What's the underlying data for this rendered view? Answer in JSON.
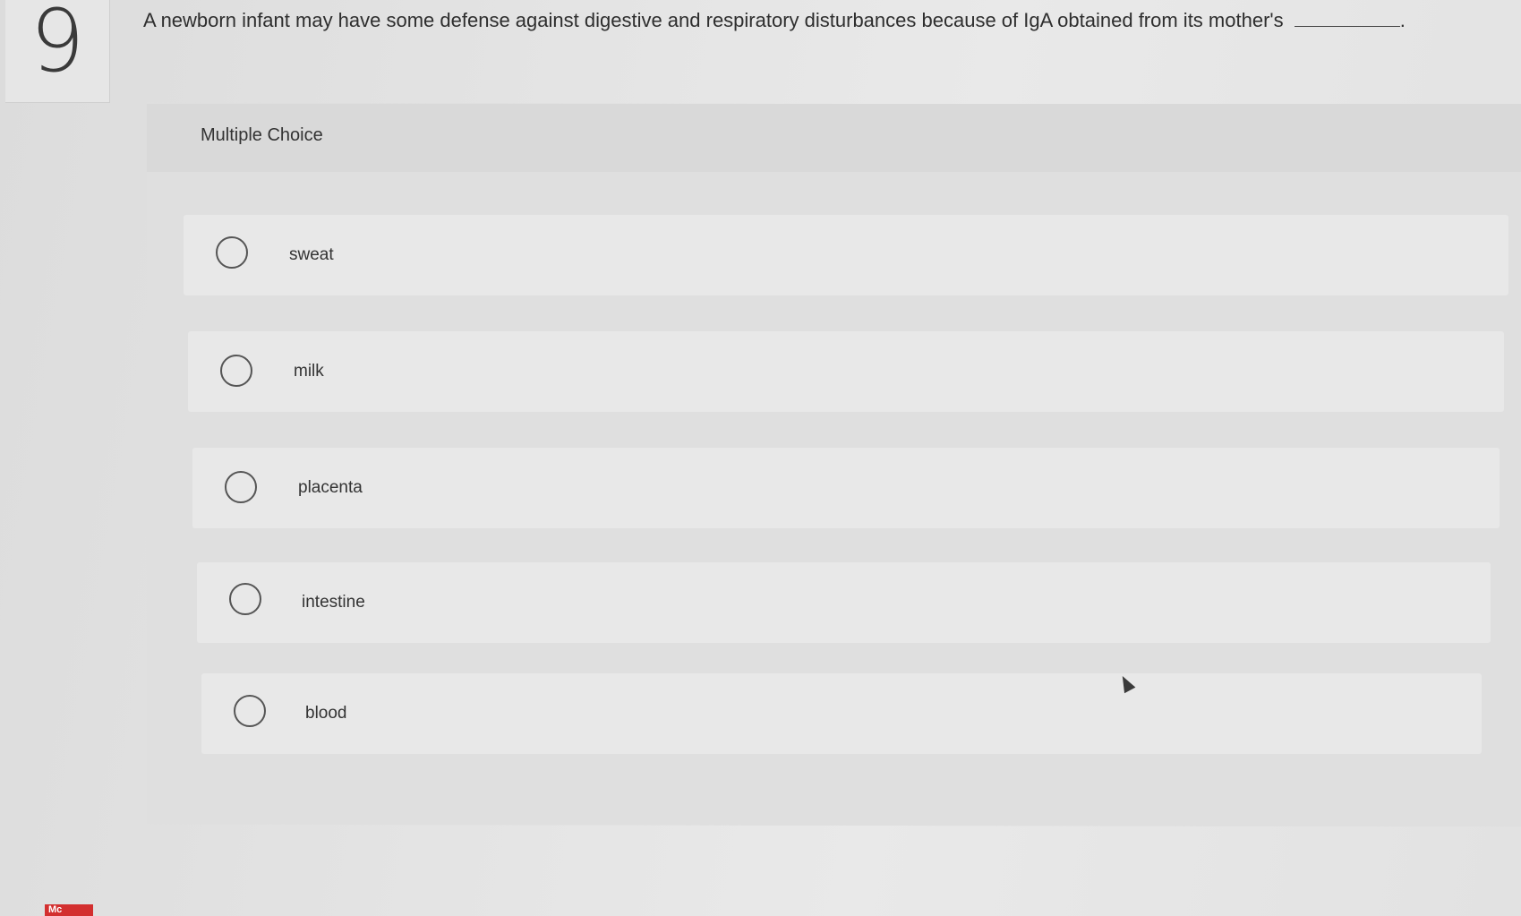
{
  "question": {
    "number": "9",
    "text": "A newborn infant may have some defense against digestive and respiratory disturbances because of IgA obtained from its mother's",
    "end_punctuation": "."
  },
  "multiple_choice": {
    "label": "Multiple Choice",
    "options": [
      {
        "label": "sweat"
      },
      {
        "label": "milk"
      },
      {
        "label": "placenta"
      },
      {
        "label": "intestine"
      },
      {
        "label": "blood"
      }
    ]
  },
  "logo": {
    "text": "Mc",
    "color": "#d32f2f"
  },
  "icons": {
    "cursor": "mouse-pointer-icon"
  }
}
